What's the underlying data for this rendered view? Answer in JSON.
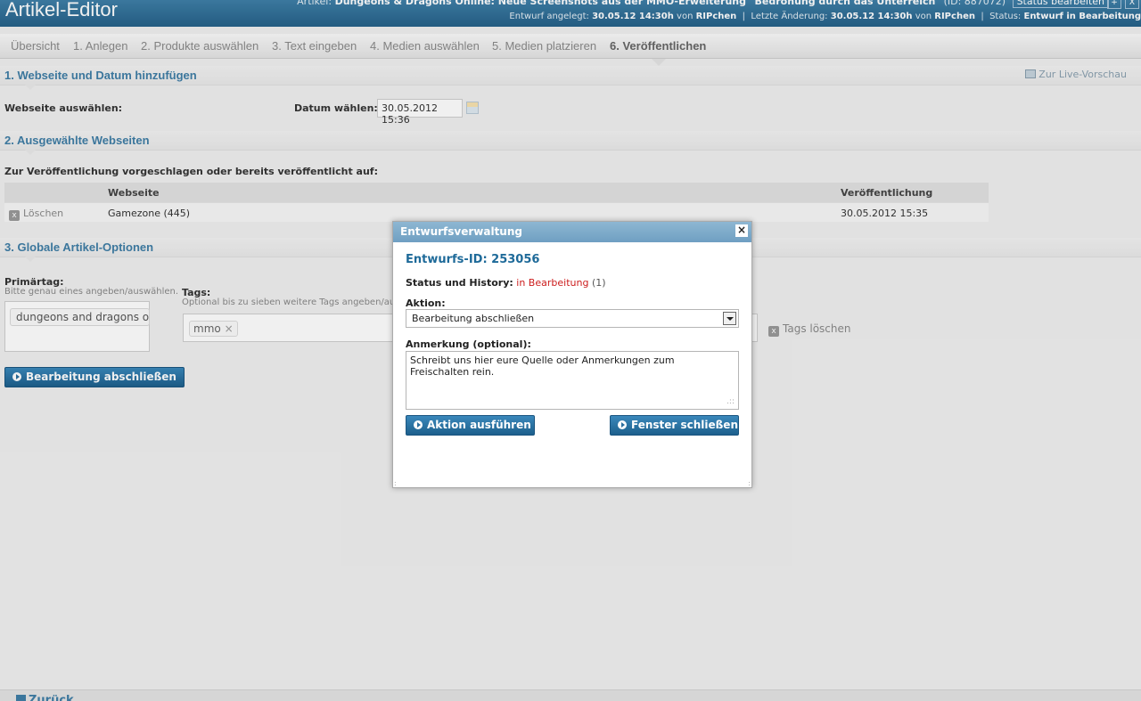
{
  "header": {
    "app_title": "Artikel-Editor",
    "article_prefix": "Artikel:",
    "article_title": "Dungeons & Dragons Online: Neue Screenshots aus der MMO-Erweiterung \"Bedrohung durch das Unterreich\"",
    "article_id": "(ID: 887072)",
    "status_edit_btn": "Status bearbeiten",
    "btn_plus": "+",
    "btn_x": "X",
    "draft_created_label": "Entwurf angelegt:",
    "draft_created_date": "30.05.12 14:30h",
    "by1": "von",
    "user1": "RIPchen",
    "sep1": "|",
    "last_change_label": "Letzte Änderung:",
    "last_change_date": "30.05.12 14:30h",
    "by2": "von",
    "user2": "RIPchen",
    "sep2": "|",
    "status_label": "Status:",
    "status_value": "Entwurf in Bearbeitung"
  },
  "steps": [
    "Übersicht",
    "1. Anlegen",
    "2. Produkte auswählen",
    "3. Text eingeben",
    "4. Medien auswählen",
    "5. Medien platzieren",
    "6. Veröffentlichen"
  ],
  "section1": {
    "title": "1. Webseite und Datum hinzufügen",
    "live_preview": "Zur Live-Vorschau",
    "website_label": "Webseite auswählen:",
    "date_label": "Datum wählen:",
    "date_value": "30.05.2012 15:36"
  },
  "section2": {
    "title": "2. Ausgewählte Webseiten",
    "intro": "Zur Veröffentlichung vorgeschlagen oder bereits veröffentlicht auf:",
    "columns": {
      "website": "Webseite",
      "publication": "Veröffentlichung"
    },
    "rows": [
      {
        "delete_label": "Löschen",
        "delete_icon": "x",
        "website": "Gamezone (445)",
        "publication": "30.05.2012 15:35"
      }
    ]
  },
  "section3": {
    "title": "3. Globale Artikel-Optionen",
    "primary_tag_label": "Primärtag:",
    "primary_tag_hint": "Bitte genau eines angeben/auswählen.",
    "primary_tag_value": "dungeons and dragons on",
    "tags_label": "Tags:",
    "tags_hint": "Optional bis zu sieben weitere Tags angeben/aus",
    "tag_chip": "mmo",
    "tag_chip_remove": "×",
    "tags_clear_icon": "x",
    "tags_clear": "Tags löschen",
    "finish_button": "Bearbeitung abschließen"
  },
  "modal": {
    "title": "Entwurfsverwaltung",
    "close": "×",
    "draft_id": "Entwurfs-ID: 253056",
    "status_label": "Status und History:",
    "status_value": "in Bearbeitung",
    "status_count": "(1)",
    "action_label": "Aktion:",
    "action_selected": "Bearbeitung abschließen",
    "note_label": "Anmerkung (optional):",
    "note_value": "Schreibt uns hier eure Quelle oder Anmerkungen zum Freischalten rein.",
    "execute_button": "Aktion ausführen",
    "close_button": "Fenster schließen"
  },
  "footer": {
    "back_link": "Zurück"
  }
}
